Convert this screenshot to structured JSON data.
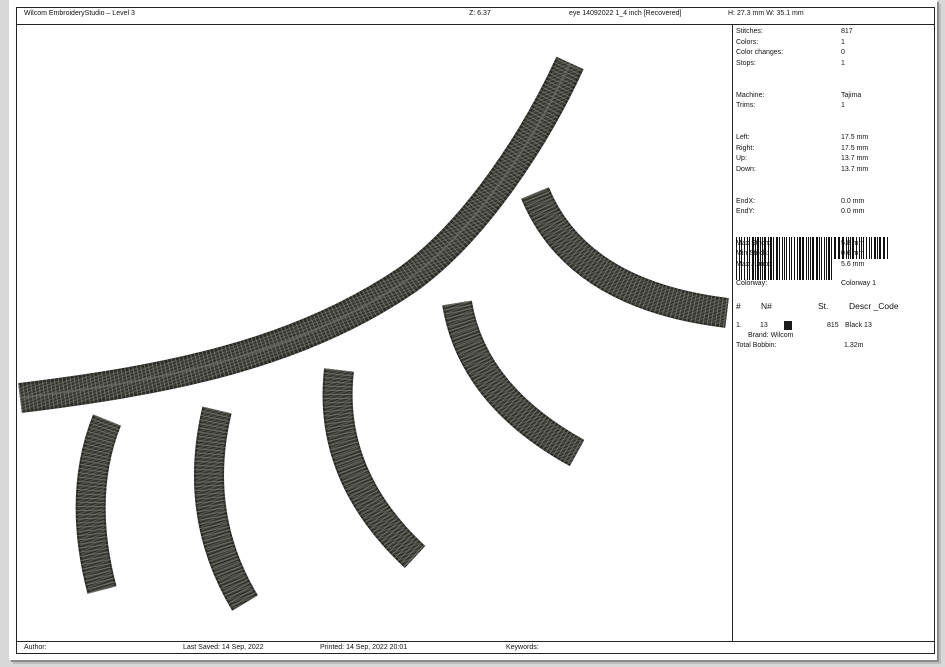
{
  "header": {
    "app": "Wilcom EmbroideryStudio – Level 3",
    "zoom": "Z: 6.37",
    "design": "eye 14092022 1_4 inch [Recovered]",
    "size": "H: 27.3 mm   W: 35.1 mm"
  },
  "stats": [
    {
      "label": "Stitches:",
      "value": "817"
    },
    {
      "label": "Colors:",
      "value": "1"
    },
    {
      "label": "Color changes:",
      "value": "0"
    },
    {
      "label": "Stops:",
      "value": "1"
    },
    null,
    null,
    {
      "label": "Machine:",
      "value": "Tajima"
    },
    {
      "label": "Trims:",
      "value": "1"
    },
    null,
    null,
    {
      "label": "Left:",
      "value": "17.5 mm"
    },
    {
      "label": "Right:",
      "value": "17.5 mm"
    },
    {
      "label": "Up:",
      "value": "13.7 mm"
    },
    {
      "label": "Down:",
      "value": "13.7 mm"
    },
    null,
    null,
    {
      "label": "EndX:",
      "value": "0.0 mm"
    },
    {
      "label": "EndY:",
      "value": "0.0 mm"
    },
    null,
    null,
    {
      "label": "Max Stitch:",
      "value": "5.8 mm"
    },
    {
      "label": "Min Stitch:",
      "value": "0.6 mm"
    },
    {
      "label": "Max Jump:",
      "value": "5.6 mm"
    }
  ],
  "colorway": {
    "label": "Colorway:",
    "value": "Colorway 1"
  },
  "table": {
    "headers": {
      "num": "#",
      "n": "N#",
      "st": "St.",
      "descr": "Descr _Code"
    },
    "rows": [
      {
        "num": "1.",
        "n": "13",
        "st": "815",
        "descr": "Black 13",
        "color": "#1b1b1b",
        "brand": "Brand: Wilcom"
      }
    ]
  },
  "bobbin": {
    "label": "Total Bobbin:",
    "value": "1.32m"
  },
  "footer": {
    "author": "Author:",
    "saved": "Last Saved: 14 Sep, 2022",
    "printed": "Printed: 14 Sep, 2022 20:01",
    "keywords": "Keywords:"
  },
  "colors": {
    "thread": "#3e3e3a",
    "thread_dark": "#1e1e1c",
    "thread_light": "#8b8b84"
  }
}
